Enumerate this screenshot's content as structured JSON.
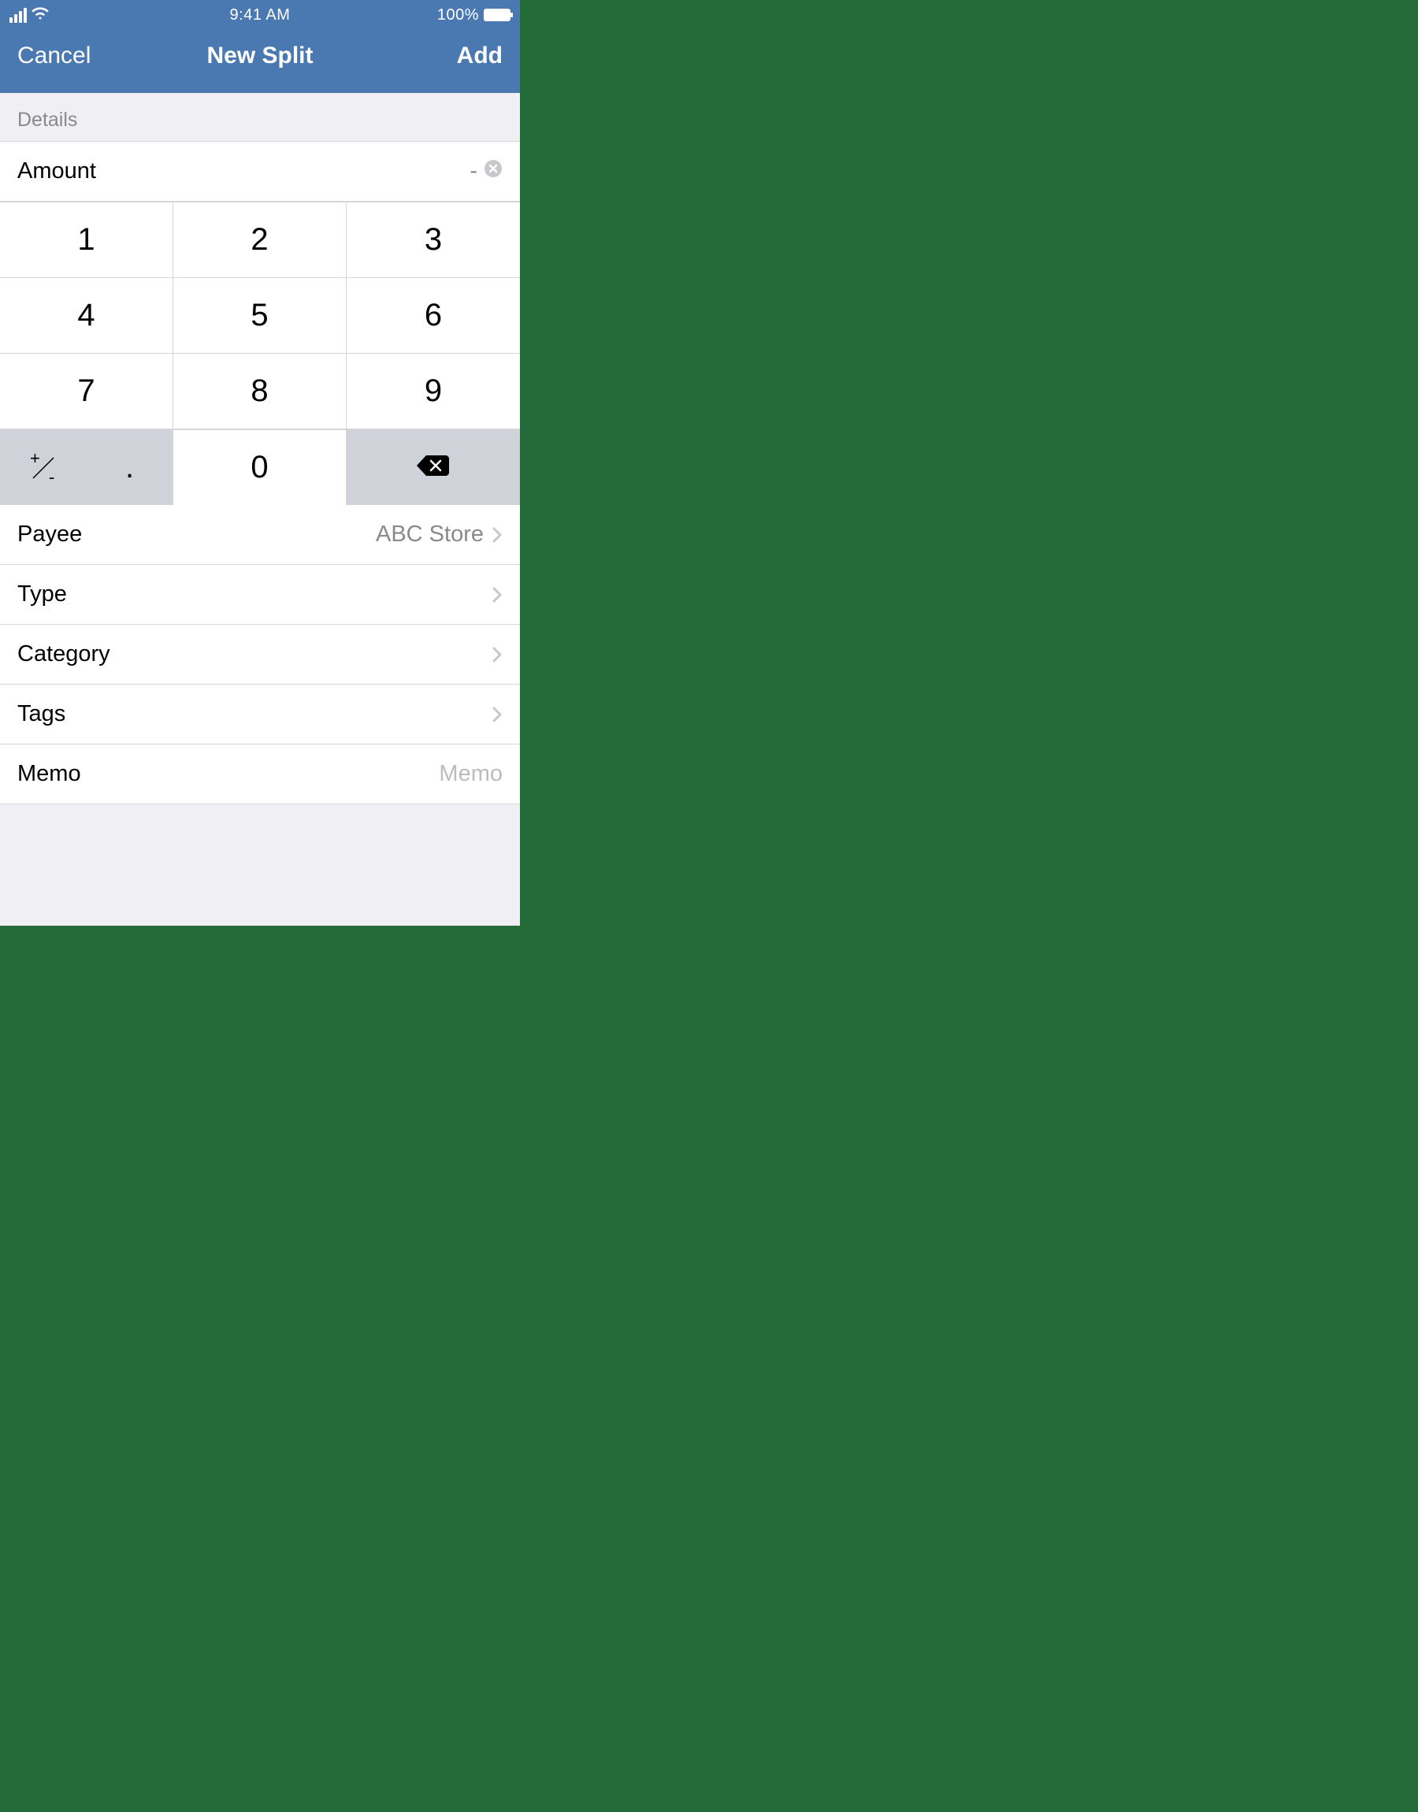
{
  "status": {
    "time": "9:41 AM",
    "battery_text": "100%"
  },
  "nav": {
    "cancel": "Cancel",
    "title": "New Split",
    "add": "Add"
  },
  "section_header": "Details",
  "amount": {
    "label": "Amount",
    "value": "-"
  },
  "keypad": {
    "k1": "1",
    "k2": "2",
    "k3": "3",
    "k4": "4",
    "k5": "5",
    "k6": "6",
    "k7": "7",
    "k8": "8",
    "k9": "9",
    "k0": "0",
    "dot": "."
  },
  "rows": {
    "payee": {
      "label": "Payee",
      "value": "ABC Store"
    },
    "type": {
      "label": "Type",
      "value": ""
    },
    "category": {
      "label": "Category",
      "value": ""
    },
    "tags": {
      "label": "Tags",
      "value": ""
    },
    "memo": {
      "label": "Memo",
      "placeholder": "Memo"
    }
  }
}
